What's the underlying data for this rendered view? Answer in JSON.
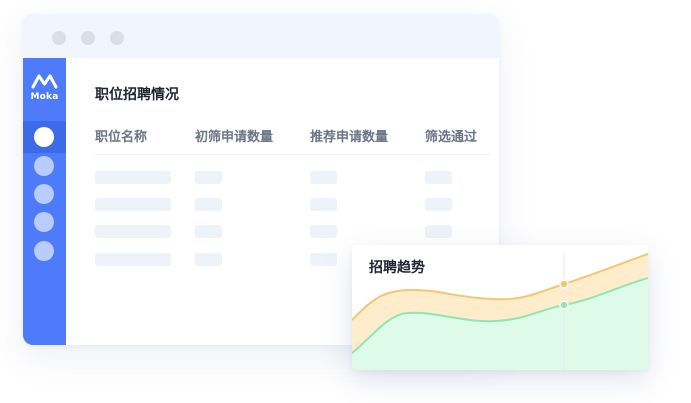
{
  "brand": {
    "name": "Moka",
    "accent": "#4d7bfa"
  },
  "window": {
    "controls": [
      "window-dot",
      "window-dot",
      "window-dot"
    ],
    "sidebar_items": [
      {
        "state": "active"
      },
      {
        "state": "inactive"
      },
      {
        "state": "inactive"
      },
      {
        "state": "inactive"
      },
      {
        "state": "inactive"
      }
    ]
  },
  "panel": {
    "title": "职位招聘情况",
    "columns": [
      "职位名称",
      "初筛申请数量",
      "推荐申请数量",
      "筛选通过"
    ],
    "placeholder_row_count": 4
  },
  "trend_card": {
    "title": "招聘趋势",
    "colors": {
      "upper_line": "#f7c56f",
      "upper_fill": "#feeccb",
      "lower_line": "#8fe6b4",
      "lower_fill": "#ddfbe8"
    }
  }
}
